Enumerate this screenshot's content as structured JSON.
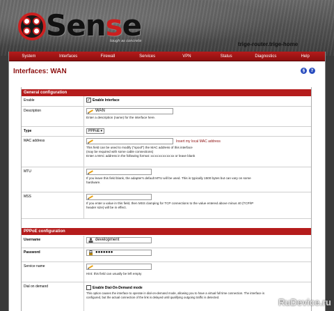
{
  "header": {
    "logo_text_a": "Sen",
    "logo_text_b": "s",
    "logo_text_c": "e",
    "tagline": "tough as concrete",
    "hostname": "trige-router.trige-home"
  },
  "nav": [
    "System",
    "Interfaces",
    "Firewall",
    "Services",
    "VPN",
    "Status",
    "Diagnostics",
    "Help"
  ],
  "page": {
    "title": "Interfaces: WAN",
    "icon1": "§",
    "icon2": "?"
  },
  "general": {
    "header": "General configuration",
    "enable_label": "Enable",
    "enable_check": "Enable Interface",
    "description_label": "Description",
    "description_value": "WAN",
    "description_hint": "Enter a description (name) for the interface here.",
    "type_label": "Type",
    "type_value": "PPPoE",
    "mac_label": "MAC address",
    "mac_link": "Insert my local MAC address",
    "mac_hint1": "This field can be used to modify (\"spoof\") the MAC address of this interface",
    "mac_hint2": "(may be required with some cable connections)",
    "mac_hint3": "Enter a MAC address in the following format: xx:xx:xx:xx:xx:xx or leave blank",
    "mtu_label": "MTU",
    "mtu_hint1": "If you leave this field blank, the adapter's default MTU will be used. This is typically 1500 bytes but can vary on some",
    "mtu_hint2": "hardware.",
    "mss_label": "MSS",
    "mss_hint1": "If you enter a value in this field, then MSS clamping for TCP connections to the value entered above minus 40 (TCP/IP",
    "mss_hint2": "header size) will be in effect."
  },
  "pppoe": {
    "header": "PPPoE configuration",
    "username_label": "Username",
    "username_value": "development",
    "password_label": "Password",
    "password_value": "●●●●●●●",
    "service_label": "Service name",
    "service_hint": "Hint: this field can usually be left empty",
    "dod_label": "Dial on demand",
    "dod_check": "Enable Dial-On-Demand mode",
    "dod_hint1": "This option causes the interface to operate in dial-on-demand mode, allowing you to have a virtual full time connection. The interface is",
    "dod_hint2": "configured, but the actual connection of the link is delayed until qualifying outgoing traffic is detected."
  },
  "watermark": "RuDevice.ru",
  "colors": {
    "accent": "#b51c1c",
    "title": "#8c0f0f",
    "help_icon": "#2a4ebf"
  }
}
